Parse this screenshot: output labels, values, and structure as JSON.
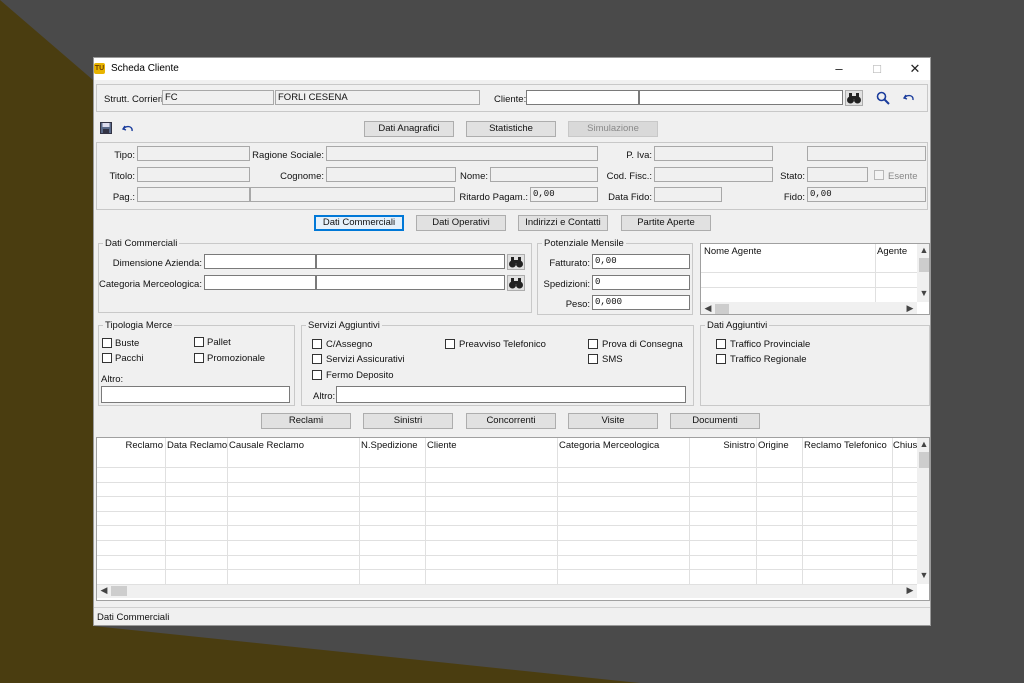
{
  "window": {
    "title": "Scheda Cliente",
    "icon_text": "TU",
    "minimize": "–",
    "maximize": "□",
    "close": "✕"
  },
  "topbar": {
    "strutt_label": "Strutt. Corrieri:",
    "strutt_code": "FC",
    "strutt_name": "FORLI CESENA",
    "cliente_label": "Cliente:",
    "cliente_code": "",
    "cliente_name": ""
  },
  "main_tabs": [
    "Dati Anagrafici",
    "Statistiche",
    "Simulazione"
  ],
  "anagrafica": {
    "tipo": "Tipo:",
    "ragione_sociale": "Ragione Sociale:",
    "piva": "P. Iva:",
    "titolo": "Titolo:",
    "cognome": "Cognome:",
    "nome": "Nome:",
    "cod_fisc": "Cod. Fisc.:",
    "stato": "Stato:",
    "esente": "Esente",
    "pag": "Pag.:",
    "ritardo": "Ritardo Pagam.:",
    "ritardo_value": "0,00",
    "data_fido": "Data Fido:",
    "fido": "Fido:",
    "fido_value": "0,00"
  },
  "sub_tabs": [
    "Dati Commerciali",
    "Dati Operativi",
    "Indirizzi e Contatti",
    "Partite Aperte"
  ],
  "dati_commerciali": {
    "title": "Dati Commerciali",
    "dimensione": "Dimensione Azienda:",
    "categoria": "Categoria Merceologica:"
  },
  "potenziale": {
    "title": "Potenziale Mensile",
    "fatturato": "Fatturato:",
    "fatturato_value": "0,00",
    "spedizioni": "Spedizioni:",
    "spedizioni_value": "0",
    "peso": "Peso:",
    "peso_value": "0,000"
  },
  "agenti": {
    "col1": "Nome Agente",
    "col2": "Agente"
  },
  "tipologia": {
    "title": "Tipologia Merce",
    "buste": "Buste",
    "pallet": "Pallet",
    "pacchi": "Pacchi",
    "promozionale": "Promozionale",
    "altro": "Altro:"
  },
  "servizi": {
    "title": "Servizi Aggiuntivi",
    "cassegno": "C/Assegno",
    "preavviso": "Preavviso Telefonico",
    "prova": "Prova di Consegna",
    "assicurativi": "Servizi Assicurativi",
    "sms": "SMS",
    "fermo": "Fermo Deposito",
    "altro": "Altro:"
  },
  "dati_aggiuntivi": {
    "title": "Dati Aggiuntivi",
    "provinciale": "Traffico Provinciale",
    "regionale": "Traffico Regionale"
  },
  "bottom_tabs": [
    "Reclami",
    "Sinistri",
    "Concorrenti",
    "Visite",
    "Documenti"
  ],
  "reclami_table": {
    "columns": [
      "Reclamo",
      "Data Reclamo",
      "Causale Reclamo",
      "N.Spedizione",
      "Cliente",
      "Categoria Merceologica",
      "Sinistro",
      "Origine",
      "Reclamo Telefonico",
      "Chiusu"
    ]
  },
  "status": "Dati Commerciali"
}
